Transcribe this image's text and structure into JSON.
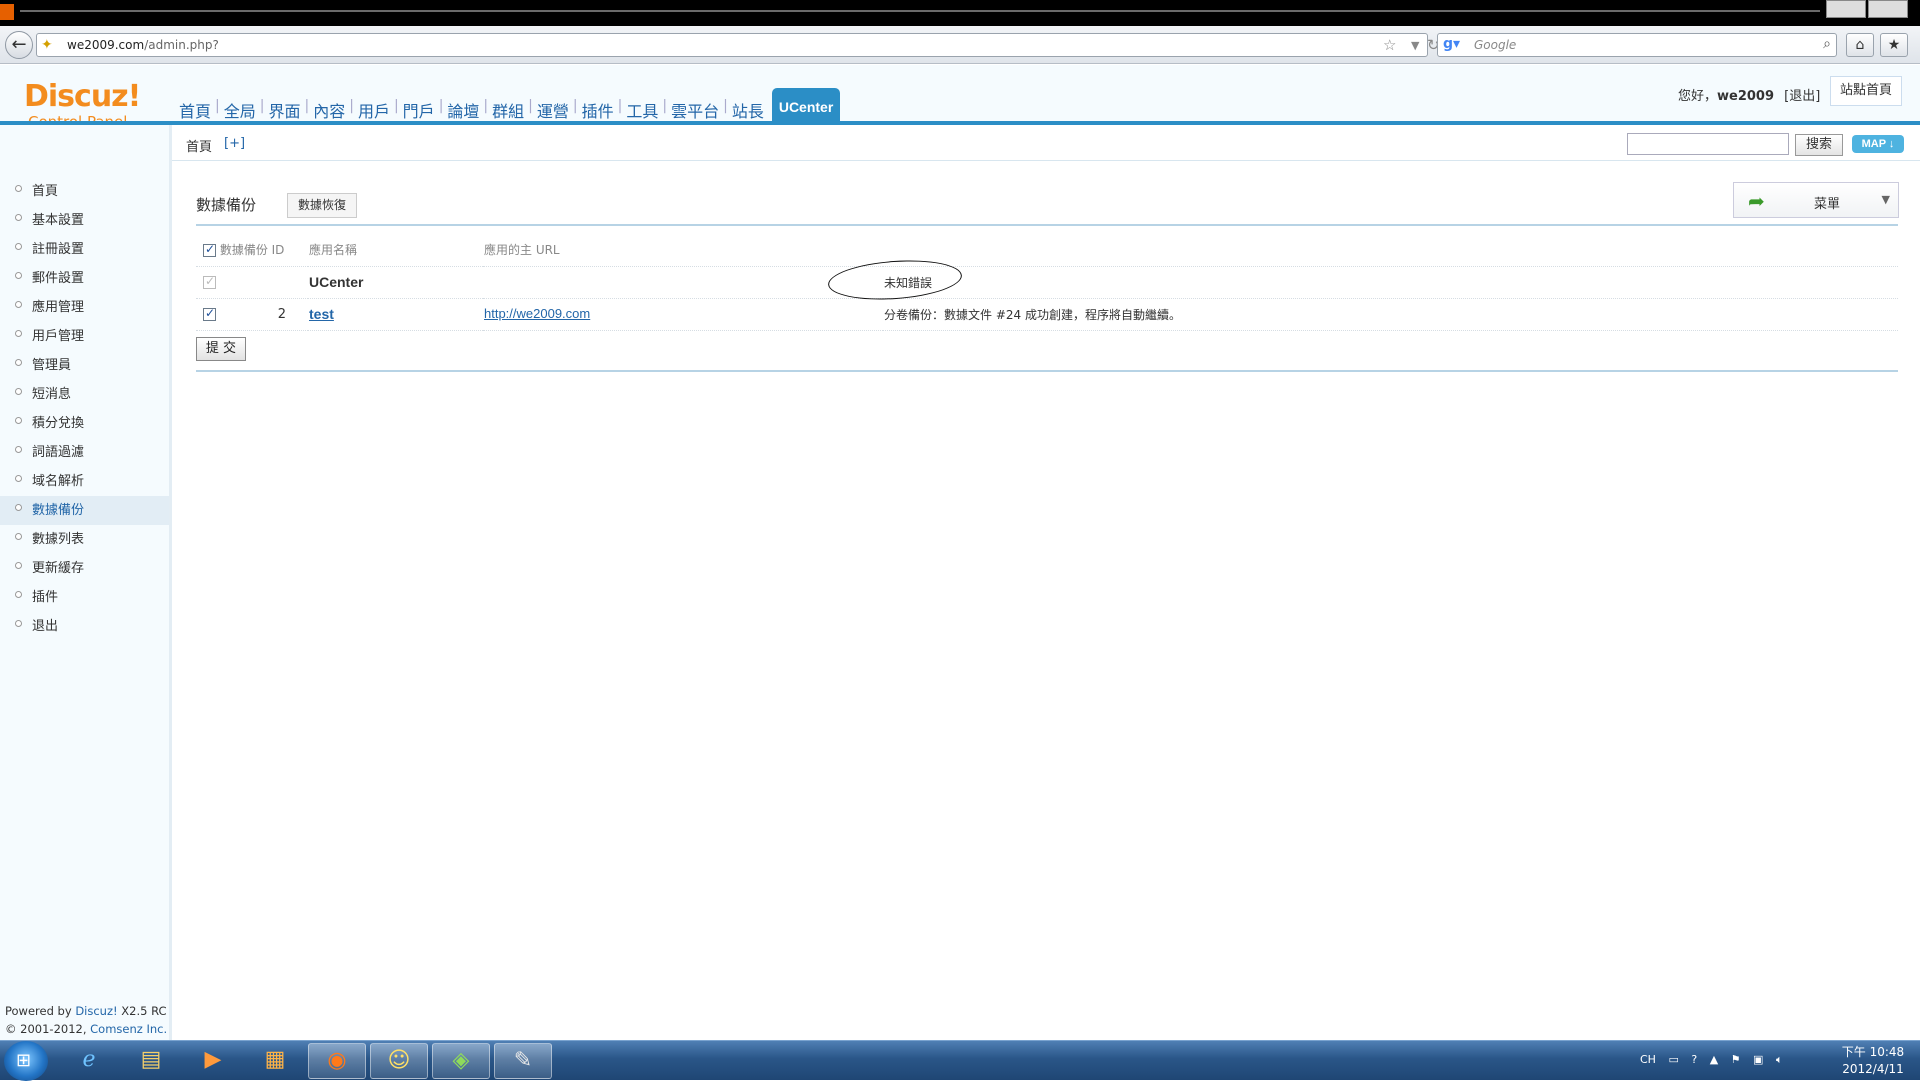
{
  "browser": {
    "url_host": "we2009.com",
    "url_path": "/admin.php?",
    "search_placeholder": "Google"
  },
  "header": {
    "logo_main": "Discuz!",
    "logo_sub": "Control Panel",
    "nav": [
      "首頁",
      "全局",
      "界面",
      "內容",
      "用戶",
      "門戶",
      "論壇",
      "群組",
      "運營",
      "插件",
      "工具",
      "雲平台",
      "站長"
    ],
    "nav_active": "UCenter",
    "greeting": "您好，",
    "username": "we2009",
    "logout": "[退出]",
    "site_home": "站點首頁"
  },
  "subbar": {
    "breadcrumb": "首頁",
    "add": "[+]",
    "search_button": "搜索",
    "map_button": "MAP"
  },
  "sidebar": {
    "items": [
      {
        "label": "首頁",
        "active": false
      },
      {
        "label": "基本設置",
        "active": false
      },
      {
        "label": "註冊設置",
        "active": false
      },
      {
        "label": "郵件設置",
        "active": false
      },
      {
        "label": "應用管理",
        "active": false
      },
      {
        "label": "用戶管理",
        "active": false
      },
      {
        "label": "管理員",
        "active": false
      },
      {
        "label": "短消息",
        "active": false
      },
      {
        "label": "積分兌換",
        "active": false
      },
      {
        "label": "詞語過濾",
        "active": false
      },
      {
        "label": "域名解析",
        "active": false
      },
      {
        "label": "數據備份",
        "active": true
      },
      {
        "label": "數據列表",
        "active": false
      },
      {
        "label": "更新緩存",
        "active": false
      },
      {
        "label": "插件",
        "active": false
      },
      {
        "label": "退出",
        "active": false
      }
    ],
    "powered_prefix": "Powered by ",
    "powered_link": "Discuz!",
    "powered_version": " X2.5 RC",
    "copyright_prefix": "© 2001-2012, ",
    "copyright_link": "Comsenz Inc."
  },
  "content": {
    "title": "數據備份",
    "restore_button": "數據恢復",
    "menu_label": "菜單",
    "columns": [
      "數據備份 ID",
      "應用名稱",
      "應用的主 URL",
      ""
    ],
    "rows": [
      {
        "id": "",
        "name": "UCenter",
        "url": "",
        "status": "未知錯誤",
        "checked": true,
        "disabled": true
      },
      {
        "id": "2",
        "name": "test",
        "url": "http://we2009.com",
        "status": "分卷備份：數據文件 #24 成功創建，程序將自動繼續。",
        "checked": true,
        "disabled": false
      }
    ],
    "submit_button": "提 交"
  },
  "taskbar": {
    "tray_lang": "CH",
    "clock_time": "下午 10:48",
    "clock_date": "2012/4/11"
  },
  "colors": {
    "accent": "#2b8ec6",
    "logo": "#f38c1e",
    "link": "#2366a8"
  }
}
